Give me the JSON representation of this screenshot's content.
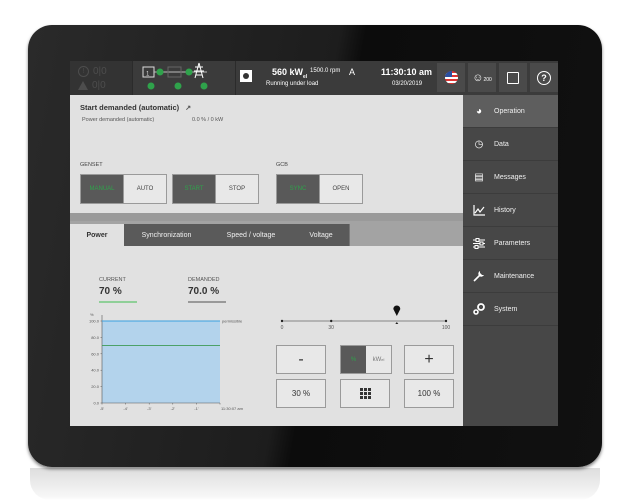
{
  "topbar": {
    "alarms": {
      "warning_count": "0|0",
      "info_count": "0|0"
    },
    "single_line": {
      "generator_number": "1",
      "breakers": [
        "closed",
        "closed"
      ],
      "status_icons": [
        "play-icon",
        "sine-icon",
        "sine-icon"
      ]
    },
    "power_value": "560 kW",
    "power_subscript": "el",
    "rpm": "1500.0 rpm",
    "running_status": "Running under load",
    "mode": "A",
    "time": "11:30:10 am",
    "date": "03/20/2019",
    "user_level": "200",
    "help_symbol": "?"
  },
  "main": {
    "status_title": "Start demanded (automatic)",
    "power_demanded_label": "Power demanded (automatic)",
    "power_demanded_value": "0.0 % / 0 kW",
    "genset_label": "GENSET",
    "gcb_label": "GCB",
    "genset_mode": {
      "left": "MANUAL",
      "right": "AUTO"
    },
    "genset_control": {
      "left": "START",
      "right": "STOP"
    },
    "gcb_control": {
      "left": "SYNC",
      "right": "OPEN"
    },
    "tabs": [
      {
        "label": "Power",
        "active": true
      },
      {
        "label": "Synchronization",
        "active": false
      },
      {
        "label": "Speed / voltage",
        "active": false
      },
      {
        "label": "Voltage",
        "active": false
      }
    ],
    "current_label": "CURRENT",
    "current_value": "70 %",
    "demanded_label": "DEMANDED",
    "demanded_value": "70.0 %",
    "slider": {
      "min_label": "0",
      "mid_label": "30",
      "max_label": "100",
      "value_percent": 70
    },
    "buttons": {
      "minus": "-",
      "plus": "+",
      "unit_percent": "%",
      "unit_kw": "kW",
      "unit_kw_sub": "el",
      "preset_low": "30 %",
      "preset_high": "100 %"
    }
  },
  "chart_data": {
    "type": "line",
    "ylabel": "%",
    "yticks": [
      "100.0",
      "80.0",
      "60.0",
      "40.0",
      "20.0",
      "0.0"
    ],
    "ylim": [
      0,
      100
    ],
    "xticks": [
      "-5'",
      "-4'",
      "-3'",
      "-2'",
      "-1'"
    ],
    "x_end_label": "11:30:07 am",
    "series": [
      {
        "name": "permissible",
        "values": [
          100,
          100,
          100,
          100,
          100,
          100
        ],
        "color": "#3aa0e0"
      },
      {
        "name": "current",
        "values": [
          70,
          70,
          70,
          70,
          70,
          70
        ],
        "color": "#3d9a55"
      }
    ],
    "x": [
      -5,
      -4,
      -3,
      -2,
      -1,
      0
    ],
    "annotation": "permissible",
    "fill_color": "#b3d3ec"
  },
  "sidebar": {
    "items": [
      {
        "label": "Operation",
        "icon": "operation-icon",
        "active": true
      },
      {
        "label": "Data",
        "icon": "gauge-icon",
        "active": false
      },
      {
        "label": "Messages",
        "icon": "messages-icon",
        "active": false
      },
      {
        "label": "History",
        "icon": "history-chart-icon",
        "active": false
      },
      {
        "label": "Parameters",
        "icon": "sliders-icon",
        "active": false
      },
      {
        "label": "Maintenance",
        "icon": "wrench-icon",
        "active": false
      },
      {
        "label": "System",
        "icon": "gears-icon",
        "active": false
      }
    ]
  },
  "colors": {
    "accent_green": "#2fa24b",
    "dark_button": "#595959",
    "sidebar_bg": "#474747"
  }
}
